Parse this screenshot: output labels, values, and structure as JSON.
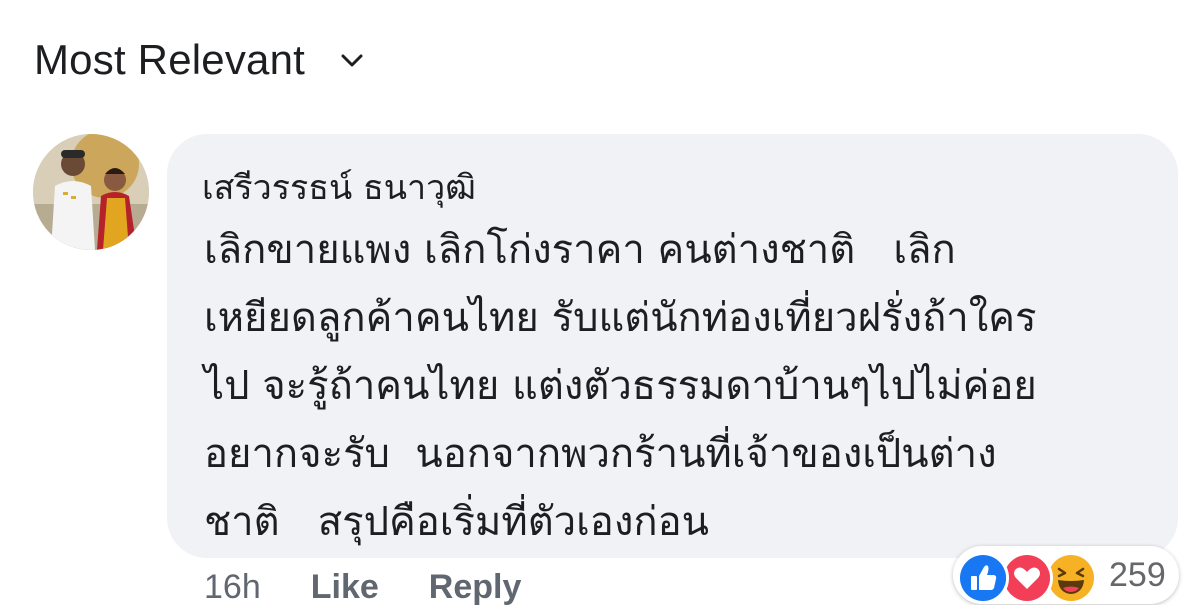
{
  "sort": {
    "label": "Most Relevant",
    "icon": "chevron-down-icon"
  },
  "comment": {
    "author": "เสรีวรรธน์ ธนาวุฒิ",
    "lines": [
      "เลิกขายแพง เลิกโก่งราคา คนต่างชาติ   เลิก",
      "เหยียดลูกค้าคนไทย รับแต่นักท่องเที่ยวฝรั่งถ้าใคร",
      "ไป จะรู้ถ้าคนไทย แต่งตัวธรรมดาบ้านๆไปไม่ค่อย",
      "อยากจะรับ  นอกจากพวกร้านที่เจ้าของเป็นต่าง",
      "ชาติ   สรุปคือเริ่มที่ตัวเองก่อน"
    ],
    "time": "16h",
    "like_label": "Like",
    "reply_label": "Reply",
    "reactions": {
      "icons": [
        "like-icon",
        "love-icon",
        "haha-icon"
      ],
      "count": "259",
      "colors": {
        "like": "#1877f2",
        "love": "#f33e58",
        "haha": "#f7b125"
      }
    }
  },
  "colors": {
    "bubble": "#f0f2f5",
    "text": "#1c1e21",
    "meta": "#606770"
  }
}
